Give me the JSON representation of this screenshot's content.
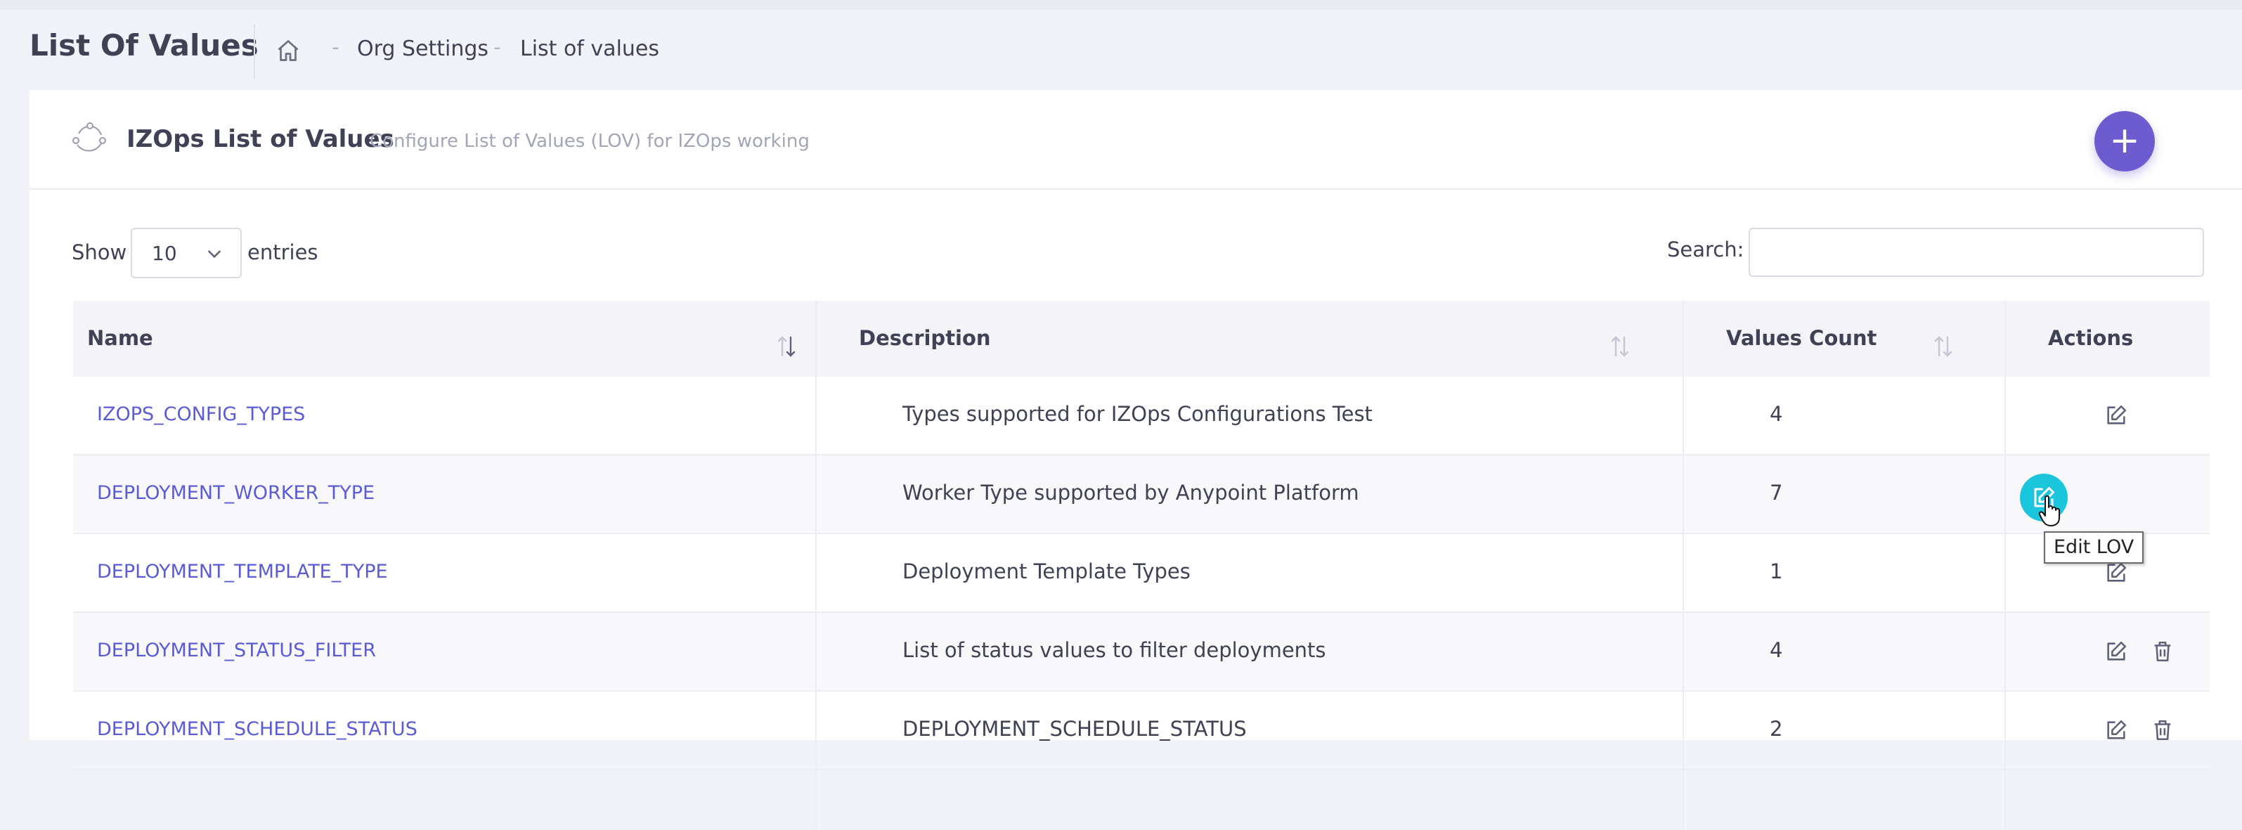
{
  "header": {
    "page_title": "List Of Values",
    "breadcrumb": [
      "Org Settings",
      "List of values"
    ],
    "breadcrumb_separator": "-"
  },
  "card": {
    "title": "IZOps List of Values",
    "subtitle": "Configure List of Values (LOV) for IZOps working",
    "add_button_icon": "plus-icon",
    "add_button_label": "+"
  },
  "controls": {
    "show_label": "Show",
    "entries_value": "10",
    "entries_label": "entries",
    "search_label": "Search:",
    "search_value": ""
  },
  "table": {
    "columns": [
      "Name",
      "Description",
      "Values Count",
      "Actions"
    ],
    "rows": [
      {
        "name": "IZOPS_CONFIG_TYPES",
        "description": "Types supported for IZOps Configurations Test",
        "count": "4",
        "deletable": false
      },
      {
        "name": "DEPLOYMENT_WORKER_TYPE",
        "description": "Worker Type supported by Anypoint Platform",
        "count": "7",
        "deletable": false,
        "hovered": true
      },
      {
        "name": "DEPLOYMENT_TEMPLATE_TYPE",
        "description": "Deployment Template Types",
        "count": "1",
        "deletable": false
      },
      {
        "name": "DEPLOYMENT_STATUS_FILTER",
        "description": "List of status values to filter deployments",
        "count": "4",
        "deletable": true
      },
      {
        "name": "DEPLOYMENT_SCHEDULE_STATUS",
        "description": "DEPLOYMENT_SCHEDULE_STATUS",
        "count": "2",
        "deletable": true
      }
    ]
  },
  "tooltip": {
    "text": "Edit LOV"
  },
  "colors": {
    "link": "#5b5bd6",
    "accent": "#6c5ccf",
    "hover_button": "#1bc5dc"
  }
}
